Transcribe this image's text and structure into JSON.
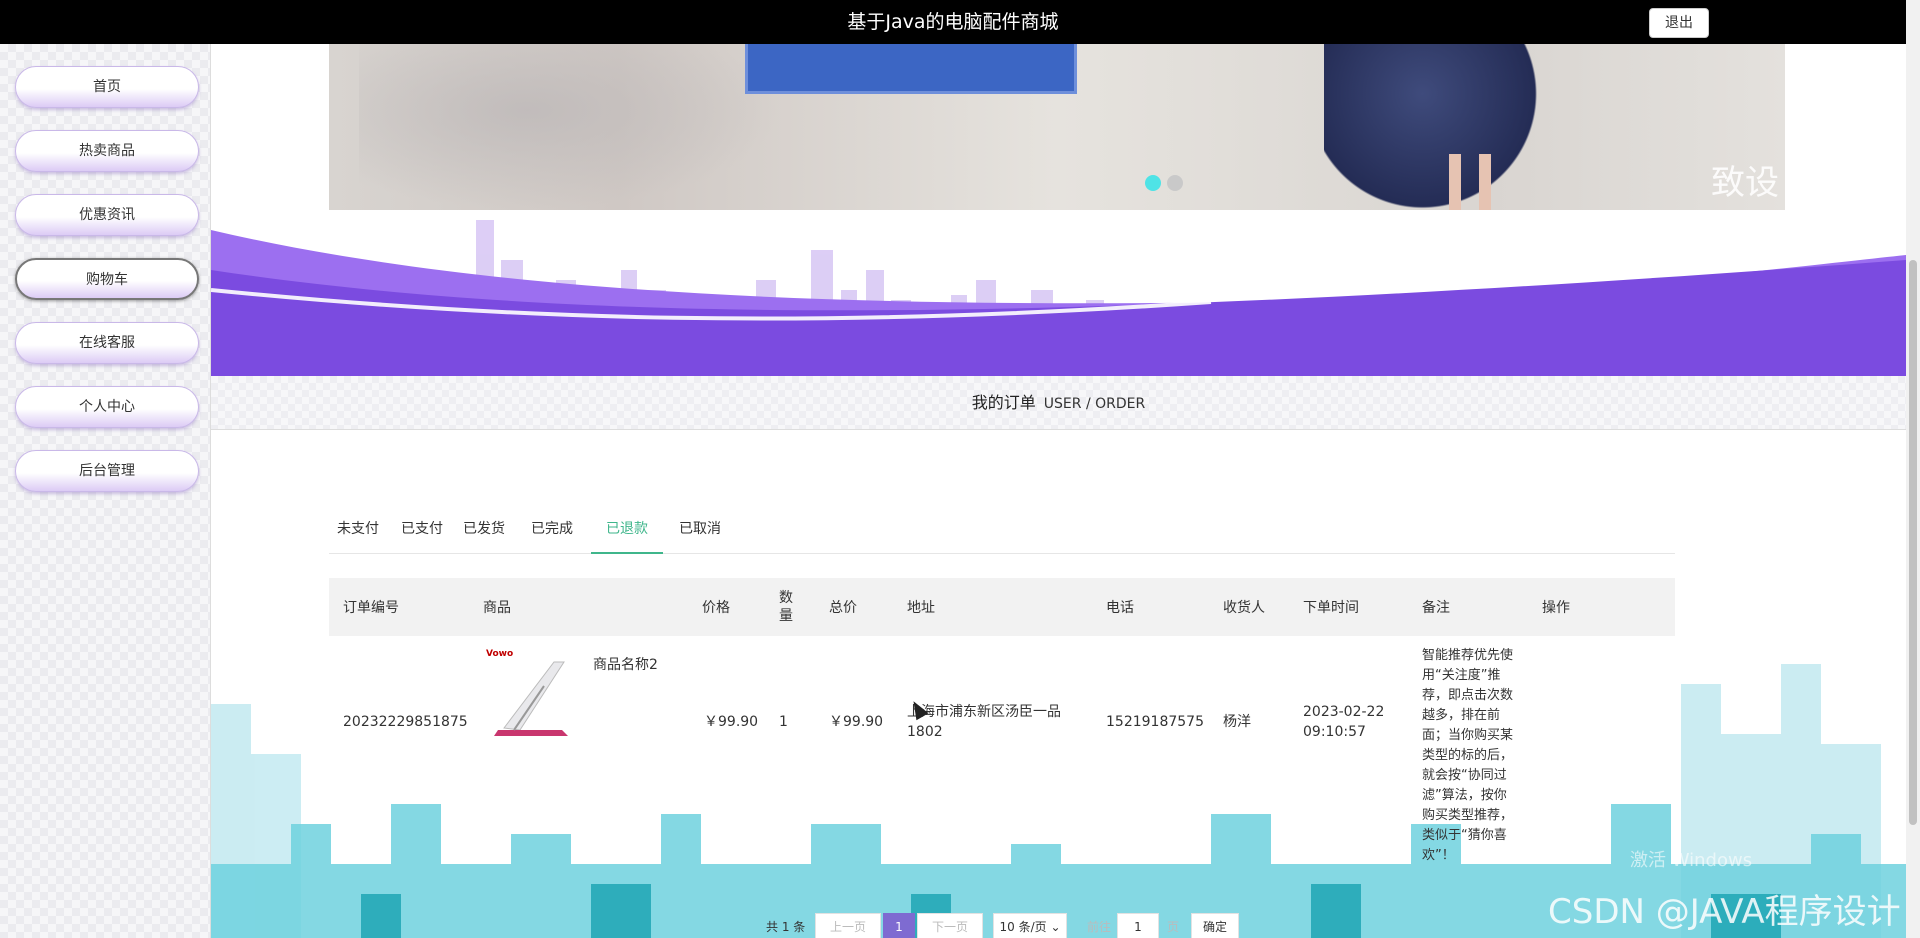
{
  "header": {
    "title": "基于Java的电脑配件商城",
    "logout_label": "退出"
  },
  "sidebar": {
    "items": [
      {
        "label": "首页"
      },
      {
        "label": "热卖商品"
      },
      {
        "label": "优惠资讯"
      },
      {
        "label": "购物车",
        "active": true
      },
      {
        "label": "在线客服"
      },
      {
        "label": "个人中心"
      },
      {
        "label": "后台管理"
      }
    ]
  },
  "banner": {
    "watermark": "致设"
  },
  "section": {
    "title": "我的订单",
    "subtitle": "USER / ORDER"
  },
  "tabs": [
    "未支付",
    "已支付",
    "已发货",
    "已完成",
    "已退款",
    "已取消"
  ],
  "active_tab": "已退款",
  "table": {
    "headers": [
      "订单编号",
      "商品",
      "价格",
      "数量",
      "总价",
      "地址",
      "电话",
      "收货人",
      "下单时间",
      "备注",
      "操作"
    ],
    "rows": [
      {
        "order_no": "20232229851875",
        "product_name": "商品名称2",
        "product_brand": "Vowo",
        "price": "￥99.90",
        "quantity": "1",
        "total": "￥99.90",
        "address": "上海市浦东新区汤臣一品1802",
        "phone": "15219187575",
        "receiver": "杨洋",
        "order_date": "2023-02-22",
        "order_time": "09:10:57",
        "note": "智能推荐优先使用“关注度”推荐，即点击次数越多，排在前面；当你购买某类型的标的后，就会按“协同过滤”算法，按你购买类型推荐，类似于“猜你喜欢”！"
      }
    ]
  },
  "pagination": {
    "total": "共 1 条",
    "prev": "上一页",
    "current": "1",
    "next": "下一页",
    "page_size": "10 条/页",
    "goto_prefix": "前往",
    "goto_value": "1",
    "goto_suffix": "页",
    "confirm": "确定"
  },
  "overlay": {
    "csdn": "CSDN @JAVA程序设计",
    "windows": "激活 Windows"
  },
  "colors": {
    "accent": "#7e6bd1",
    "tab_active": "#3fb68b",
    "wave": "#7b4be0"
  }
}
